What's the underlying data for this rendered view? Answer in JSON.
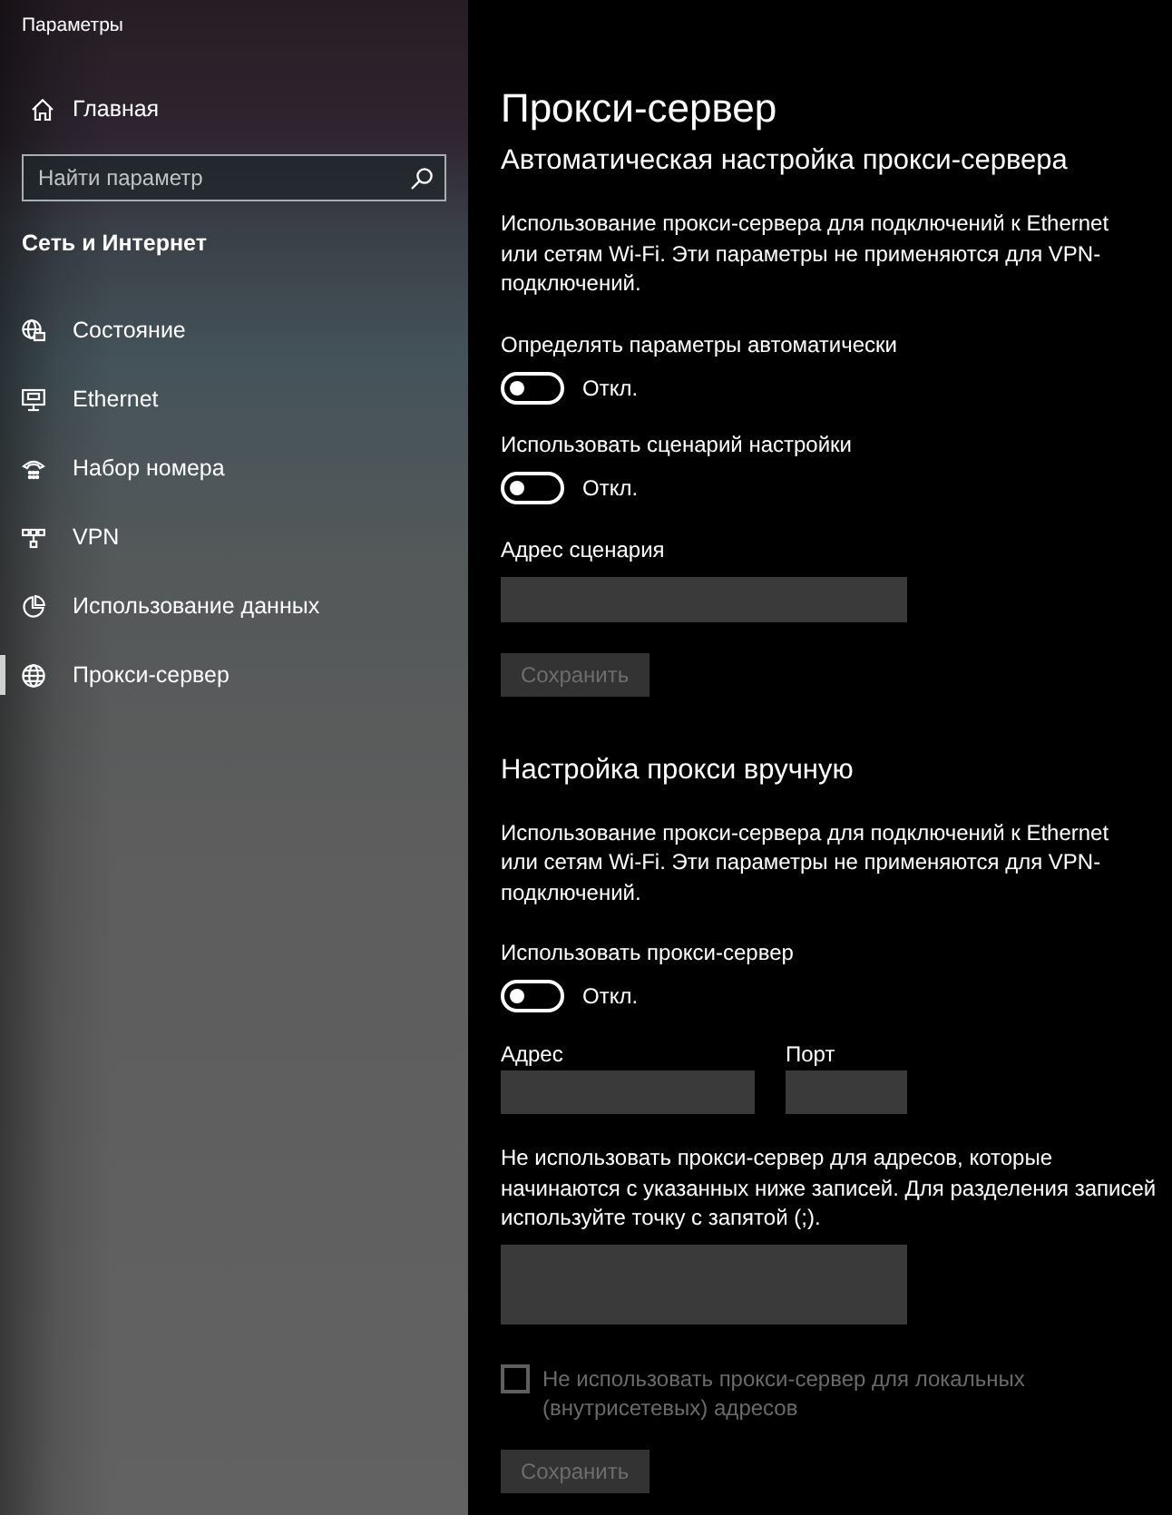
{
  "window": {
    "title": "Параметры"
  },
  "sidebar": {
    "home": {
      "label": "Главная"
    },
    "search": {
      "placeholder": "Найти параметр"
    },
    "category": "Сеть и Интернет",
    "items": [
      {
        "kind": "status",
        "label": "Состояние",
        "selected": false
      },
      {
        "kind": "ethernet",
        "label": "Ethernet",
        "selected": false
      },
      {
        "kind": "dialup",
        "label": "Набор номера",
        "selected": false
      },
      {
        "kind": "vpn",
        "label": "VPN",
        "selected": false
      },
      {
        "kind": "usage",
        "label": "Использование данных",
        "selected": false
      },
      {
        "kind": "proxy",
        "label": "Прокси-сервер",
        "selected": true
      }
    ]
  },
  "page": {
    "title": "Прокси-сервер",
    "sections": [
      {
        "heading": "Автоматическая настройка прокси-сервера",
        "controls": [
          {
            "kind": "text",
            "text": "Использование прокси-сервера для подключений к Ethernet или сетям Wi-Fi. Эти параметры не применяются для VPN-подключений."
          },
          {
            "kind": "toggle",
            "label": "Определять параметры автоматически",
            "on": false,
            "state_label": "Откл."
          },
          {
            "kind": "toggle",
            "label": "Использовать сценарий настройки",
            "on": false,
            "state_label": "Откл."
          },
          {
            "kind": "field",
            "label": "Адрес сценария"
          },
          {
            "kind": "button",
            "label": "Сохранить",
            "disabled": true
          }
        ]
      },
      {
        "heading": "Настройка прокси вручную",
        "controls": [
          {
            "kind": "text",
            "text": "Использование прокси-сервера для подключений к Ethernet или сетям Wi-Fi. Эти параметры не применяются для VPN-подключений."
          },
          {
            "kind": "toggle",
            "label": "Использовать прокси-сервер",
            "on": false,
            "state_label": "Откл."
          },
          {
            "kind": "fields",
            "fields": [
              {
                "label": "Адрес"
              },
              {
                "label": "Порт"
              }
            ]
          },
          {
            "kind": "text",
            "text": "Не использовать прокси-сервер для адресов, которые начинаются с указанных ниже записей. Для разделения записей используйте точку с запятой (;)."
          },
          {
            "kind": "textarea"
          },
          {
            "kind": "checkbox",
            "label": "Не использовать прокси-сервер для локальных (внутрисетевых) адресов",
            "checked": false,
            "disabled": true
          },
          {
            "kind": "button",
            "label": "Сохранить",
            "disabled": true
          }
        ]
      }
    ]
  }
}
